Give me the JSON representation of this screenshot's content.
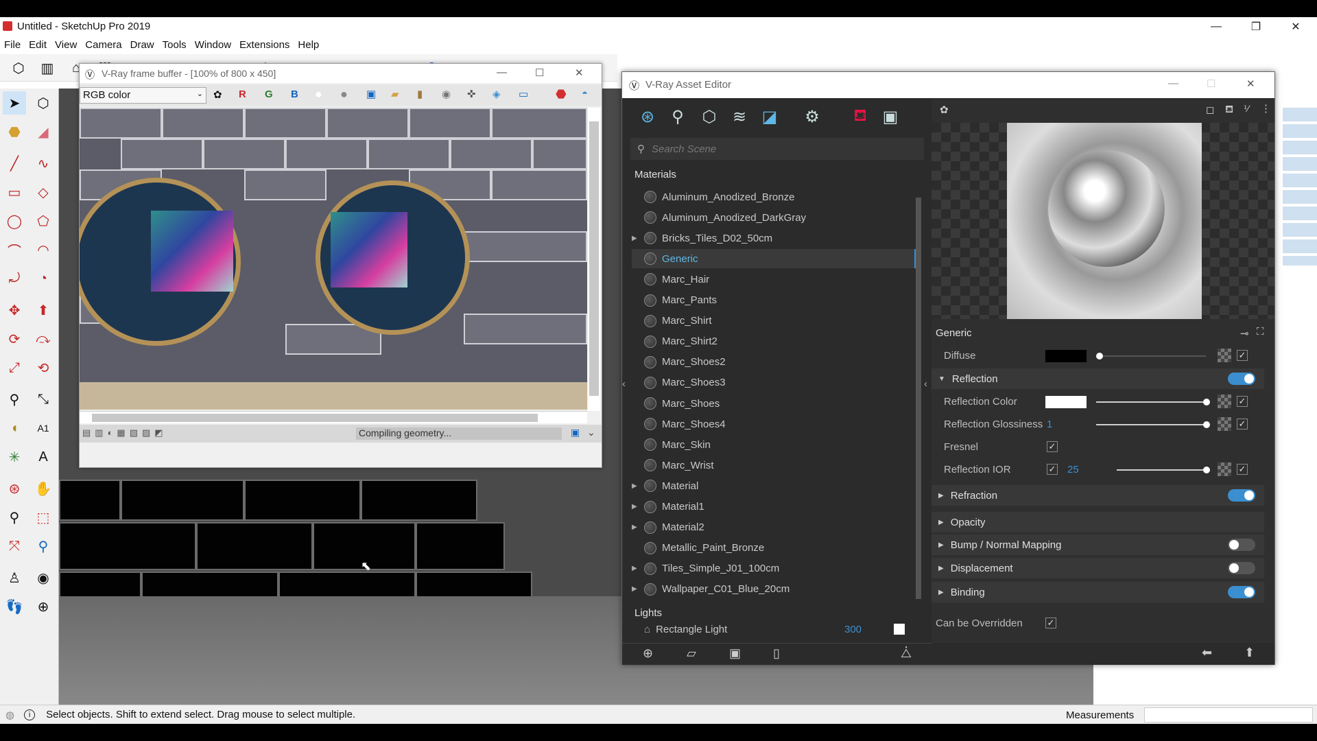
{
  "window": {
    "title": "Untitled - SketchUp Pro 2019",
    "min": "—",
    "max": "❐",
    "close": "✕"
  },
  "menu": [
    "File",
    "Edit",
    "View",
    "Camera",
    "Draw",
    "Tools",
    "Window",
    "Extensions",
    "Help"
  ],
  "status": {
    "info_icon": "info-icon",
    "text": "Select objects. Shift to extend select. Drag mouse to select multiple.",
    "measurements_label": "Measurements"
  },
  "frame_buffer": {
    "title": "V-Ray frame buffer - [100% of 800 x 450]",
    "channel": "RGB color",
    "channel_r": "R",
    "channel_g": "G",
    "channel_b": "B",
    "status": "Compiling geometry...",
    "min": "—",
    "max": "☐",
    "close": "✕"
  },
  "asset_editor": {
    "title": "V-Ray Asset Editor",
    "min": "—",
    "max": "☐",
    "close": "✕",
    "search_placeholder": "Search Scene",
    "materials_header": "Materials",
    "materials": [
      {
        "name": "Aluminum_Anodized_Bronze",
        "expandable": false
      },
      {
        "name": "Aluminum_Anodized_DarkGray",
        "expandable": false
      },
      {
        "name": "Bricks_Tiles_D02_50cm",
        "expandable": true
      },
      {
        "name": "Generic",
        "expandable": false,
        "selected": true
      },
      {
        "name": "Marc_Hair",
        "expandable": false
      },
      {
        "name": "Marc_Pants",
        "expandable": false
      },
      {
        "name": "Marc_Shirt",
        "expandable": false
      },
      {
        "name": "Marc_Shirt2",
        "expandable": false
      },
      {
        "name": "Marc_Shoes2",
        "expandable": false
      },
      {
        "name": "Marc_Shoes3",
        "expandable": false
      },
      {
        "name": "Marc_Shoes",
        "expandable": false
      },
      {
        "name": "Marc_Shoes4",
        "expandable": false
      },
      {
        "name": "Marc_Skin",
        "expandable": false
      },
      {
        "name": "Marc_Wrist",
        "expandable": false
      },
      {
        "name": "Material",
        "expandable": true
      },
      {
        "name": "Material1",
        "expandable": true
      },
      {
        "name": "Material2",
        "expandable": true
      },
      {
        "name": "Metallic_Paint_Bronze",
        "expandable": false
      },
      {
        "name": "Tiles_Simple_J01_100cm",
        "expandable": true
      },
      {
        "name": "Wallpaper_C01_Blue_20cm",
        "expandable": true
      }
    ],
    "lights_header": "Lights",
    "light": {
      "name": "Rectangle Light",
      "intensity": "300"
    },
    "selected_material": "Generic",
    "props": {
      "diffuse": "Diffuse",
      "reflection": "Reflection",
      "reflection_color": "Reflection Color",
      "reflection_glossiness": "Reflection Glossiness",
      "reflection_glossiness_value": "1",
      "fresnel": "Fresnel",
      "reflection_ior": "Reflection IOR",
      "reflection_ior_value": "25",
      "refraction": "Refraction",
      "opacity": "Opacity",
      "bump": "Bump / Normal Mapping",
      "displacement": "Displacement",
      "binding": "Binding",
      "can_be_overridden": "Can be Overridden"
    },
    "toggles": {
      "reflection": true,
      "refraction": true,
      "bump": false,
      "displacement": false,
      "binding": true
    },
    "colors": {
      "diffuse": "#000000",
      "reflection_color": "#ffffff",
      "accent": "#3b8fd0"
    }
  }
}
